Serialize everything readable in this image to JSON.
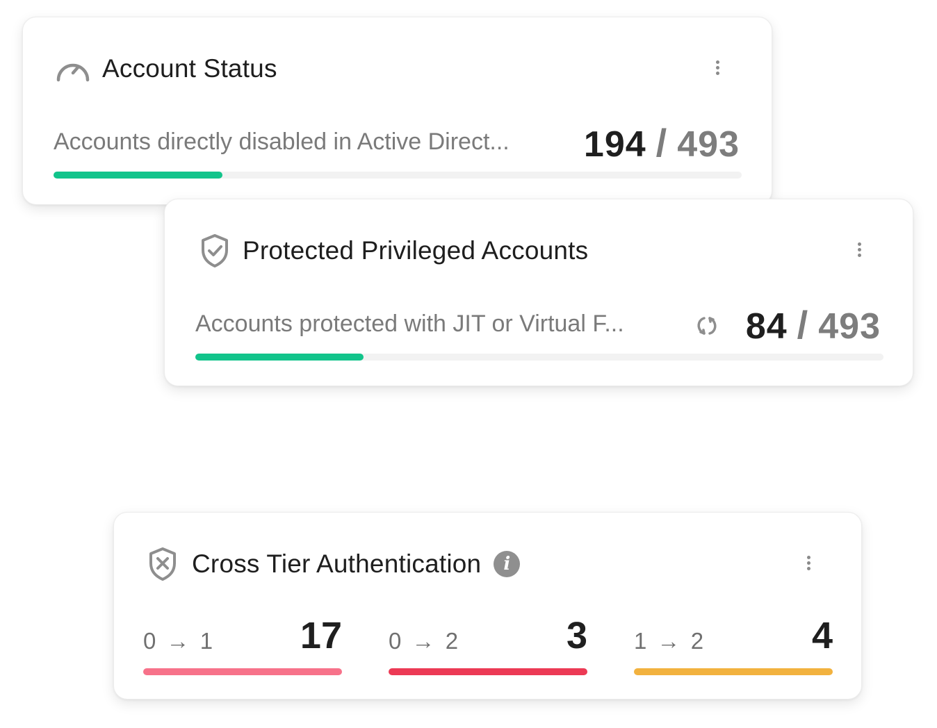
{
  "account_status": {
    "title": "Account Status",
    "icon": "gauge-icon",
    "metric_label": "Accounts directly disabled in Active Direct...",
    "value": "194",
    "separator": "/",
    "total": "493",
    "progress_fraction": 0.2451,
    "bar_color": "#12c48b"
  },
  "protected_privileged": {
    "title": "Protected Privileged Accounts",
    "icon": "shield-check-icon",
    "metric_label": "Accounts protected with JIT or Virtual F...",
    "sync_icon": "sync-icon",
    "value": "84",
    "separator": "/",
    "total": "493",
    "progress_fraction": 0.2446,
    "bar_color": "#12c48b"
  },
  "cross_tier": {
    "title": "Cross Tier Authentication",
    "icon": "shield-cross-icon",
    "info_glyph": "i",
    "tiers": [
      {
        "from": "0",
        "arrow": "→",
        "to": "1",
        "count": "17",
        "color": "#f7728a"
      },
      {
        "from": "0",
        "arrow": "→",
        "to": "2",
        "count": "3",
        "color": "#ec3a55"
      },
      {
        "from": "1",
        "arrow": "→",
        "to": "2",
        "count": "4",
        "color": "#f2b23f"
      }
    ]
  }
}
